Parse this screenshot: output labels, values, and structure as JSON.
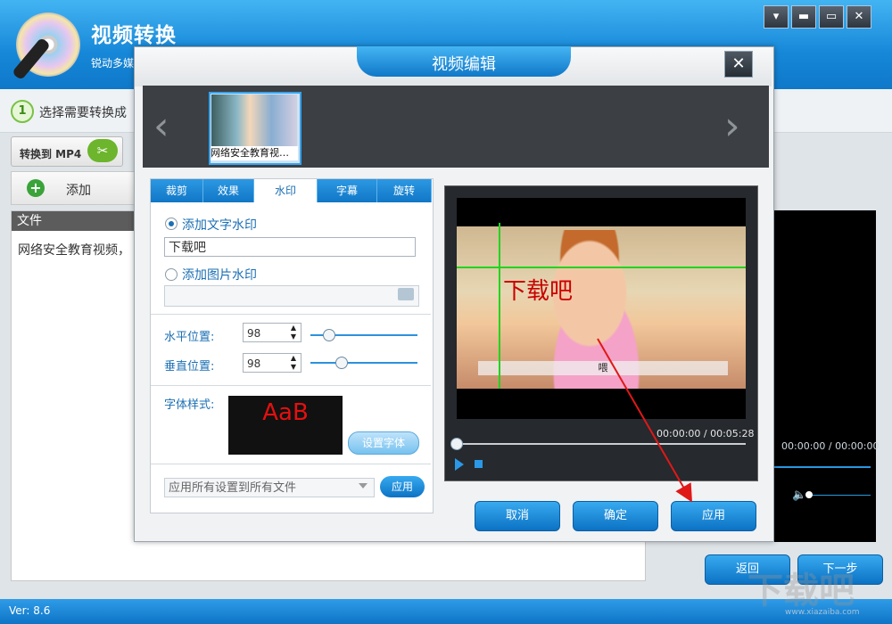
{
  "app": {
    "title": "视频转换",
    "subtitle": "锐动多媒",
    "version": "Ver: 8.6",
    "step_number": "1",
    "step_text": "选择需要转换成",
    "convert_label": "转换到 MP4",
    "add_label": "添加",
    "file_header": "文件",
    "file_row": "网络安全教育视频，",
    "right_time": "00:00:00 / 00:00:00",
    "back_label": "返回",
    "next_label": "下一步",
    "watermark_logo": "下载吧",
    "watermark_url": "www.xiazaiba.com"
  },
  "dialog": {
    "title": "视频编辑",
    "close_glyph": "✕",
    "thumbnail_label": "网络安全教育视…",
    "tabs": [
      "裁剪",
      "效果",
      "水印",
      "字幕",
      "旋转"
    ],
    "active_tab": "水印",
    "text_watermark_label": "添加文字水印",
    "text_watermark_value": "下载吧",
    "image_watermark_label": "添加图片水印",
    "hpos_label": "水平位置:",
    "hpos_value": "98",
    "vpos_label": "垂直位置:",
    "vpos_value": "98",
    "font_label": "字体样式:",
    "font_sample": "AaB",
    "set_font_label": "设置字体",
    "apply_all_label": "应用所有设置到所有文件",
    "apply_small_label": "应用",
    "video_caption": "喂",
    "time_display": "00:00:00 / 00:05:28",
    "cancel_label": "取消",
    "ok_label": "确定",
    "apply_label": "应用"
  },
  "colors": {
    "accent": "#1687d8",
    "watermark_red": "#c80000",
    "guide_green": "#1fd51f",
    "arrow_red": "#e01818"
  },
  "icons": {
    "minimize": "▾",
    "restore": "▬",
    "maximize": "▭",
    "close": "✕",
    "prev": "‹",
    "next": "›",
    "add": "+",
    "tools": "✂"
  }
}
